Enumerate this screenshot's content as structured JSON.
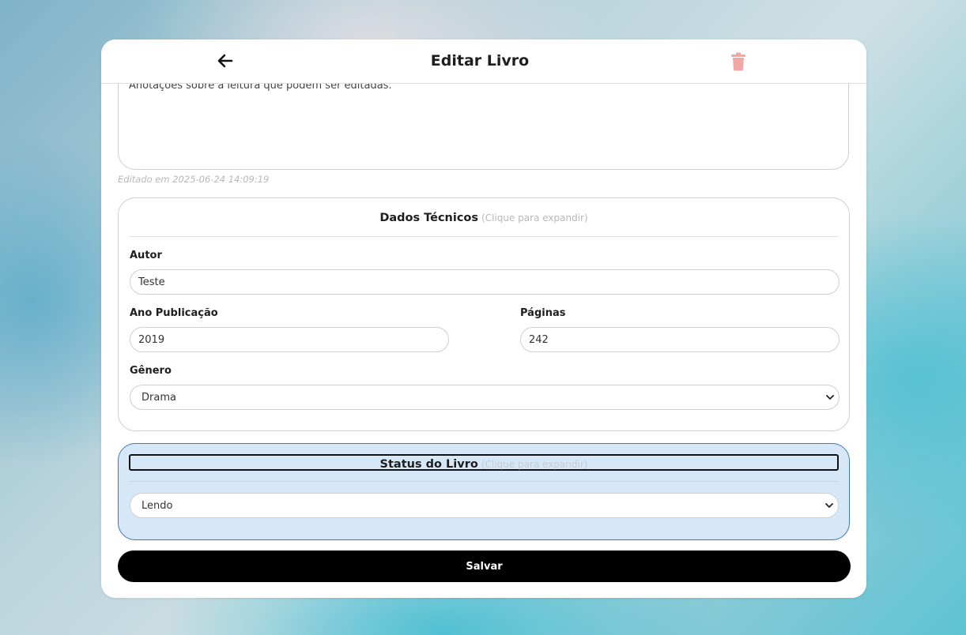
{
  "header": {
    "title": "Editar Livro",
    "back_icon": "arrow-left-icon",
    "delete_icon": "trash-icon"
  },
  "notes": {
    "text": "Anotações sobre a leitura que podem ser editadas.",
    "edited_label": "Editado em 2025-06-24 14:09:19"
  },
  "technical": {
    "title": "Dados Técnicos",
    "hint": "(Clique para expandir)",
    "author_label": "Autor",
    "author_value": "Teste",
    "year_label": "Ano Publicação",
    "year_value": "2019",
    "pages_label": "Páginas",
    "pages_value": "242",
    "genre_label": "Gênero",
    "genre_value": "Drama"
  },
  "status": {
    "title": "Status do Livro",
    "hint": "(Clique para expandir)",
    "value": "Lendo"
  },
  "actions": {
    "save_label": "Salvar"
  },
  "colors": {
    "accent_status_bg": "#d6e8f8",
    "accent_status_border": "#3e78b6",
    "delete_icon": "#f4a6a6",
    "save_button": "#000000"
  }
}
